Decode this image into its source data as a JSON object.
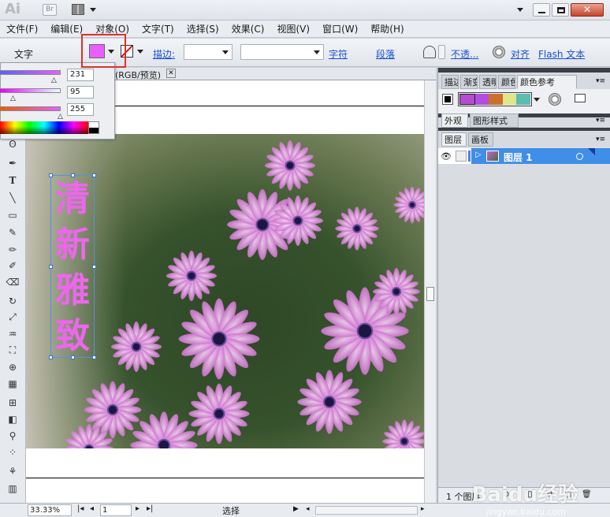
{
  "app": {
    "logo": "Ai",
    "br_label": "Br"
  },
  "menu": [
    "文件(F)",
    "编辑(E)",
    "对象(O)",
    "文字(T)",
    "选择(S)",
    "效果(C)",
    "视图(V)",
    "窗口(W)",
    "帮助(H)"
  ],
  "control": {
    "tool_label": "文字",
    "stroke_label": "描边:",
    "char_link": "字符",
    "para_link": "段落",
    "opacity_link": "不透...",
    "align_link": "对齐",
    "flash_link": "Flash 文本"
  },
  "color_panel": {
    "r": "231",
    "g": "95",
    "b": "255",
    "fill_color": "#e75fff"
  },
  "document": {
    "tab_title": "(RGB/预览)",
    "text_lines": [
      "清",
      "新",
      "雅",
      "致"
    ],
    "text_color": "#ee66ee"
  },
  "panels": {
    "tabs_top": [
      "描边",
      "渐变",
      "透明",
      "颜色",
      "颜色参考"
    ],
    "tabs_mid": [
      "外观",
      "图形样式"
    ],
    "tabs_layers": [
      "图层",
      "画板"
    ],
    "layer_name": "图层 1",
    "layer_count": "1 个图层"
  },
  "status": {
    "zoom": "33.33%",
    "page": "1",
    "mode": "选择"
  },
  "swatches": [
    "#b44dcf",
    "#b14de0",
    "#cc6f2e",
    "#e2e68a",
    "#5cbcb0"
  ],
  "watermark": {
    "main": "Baidu经验",
    "sub": "jingyan.baidu.com"
  }
}
